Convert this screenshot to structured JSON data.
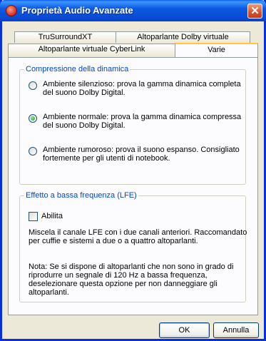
{
  "window": {
    "title": "Proprietà Audio Avanzate",
    "close_glyph": "✕"
  },
  "tabs": {
    "row1": [
      "TruSurroundXT",
      "Altoparlante Dolby virtuale"
    ],
    "row2": [
      "Altoparlante virtuale CyberLink",
      "Varie"
    ],
    "active": "Varie"
  },
  "compression": {
    "legend": "Compressione della dinamica",
    "options": [
      {
        "label": "Ambiente silenzioso: prova la gamma dinamica completa del suono Dolby Digital.",
        "checked": false
      },
      {
        "label": "Ambiente normale: prova la gamma dinamica compressa del suono Dolby Digital.",
        "checked": true
      },
      {
        "label": "Ambiente rumoroso: prova il suono espanso. Consigliato fortemente per gli utenti di notebook.",
        "checked": false
      }
    ]
  },
  "lfe": {
    "legend": "Effetto a bassa frequenza (LFE)",
    "checkbox_label": "Abilita",
    "checked": false,
    "description": "Miscela il canale LFE con i due canali anteriori. Raccomandato per cuffie e sistemi a due o a quattro altoparlanti.",
    "note": "Nota: Se si dispone di altoparlanti che non sono in grado di riprodurre un segnale di 120 Hz a bassa frequenza, deselezionare questa opzione per non danneggiare gli altoparlanti."
  },
  "buttons": {
    "ok": "OK",
    "cancel": "Annulla"
  },
  "colors": {
    "titlebar": "#0a5ee6",
    "legend_text": "#0046d5",
    "active_tab_accent": "#ffc83c",
    "close_button": "#d6502e"
  }
}
